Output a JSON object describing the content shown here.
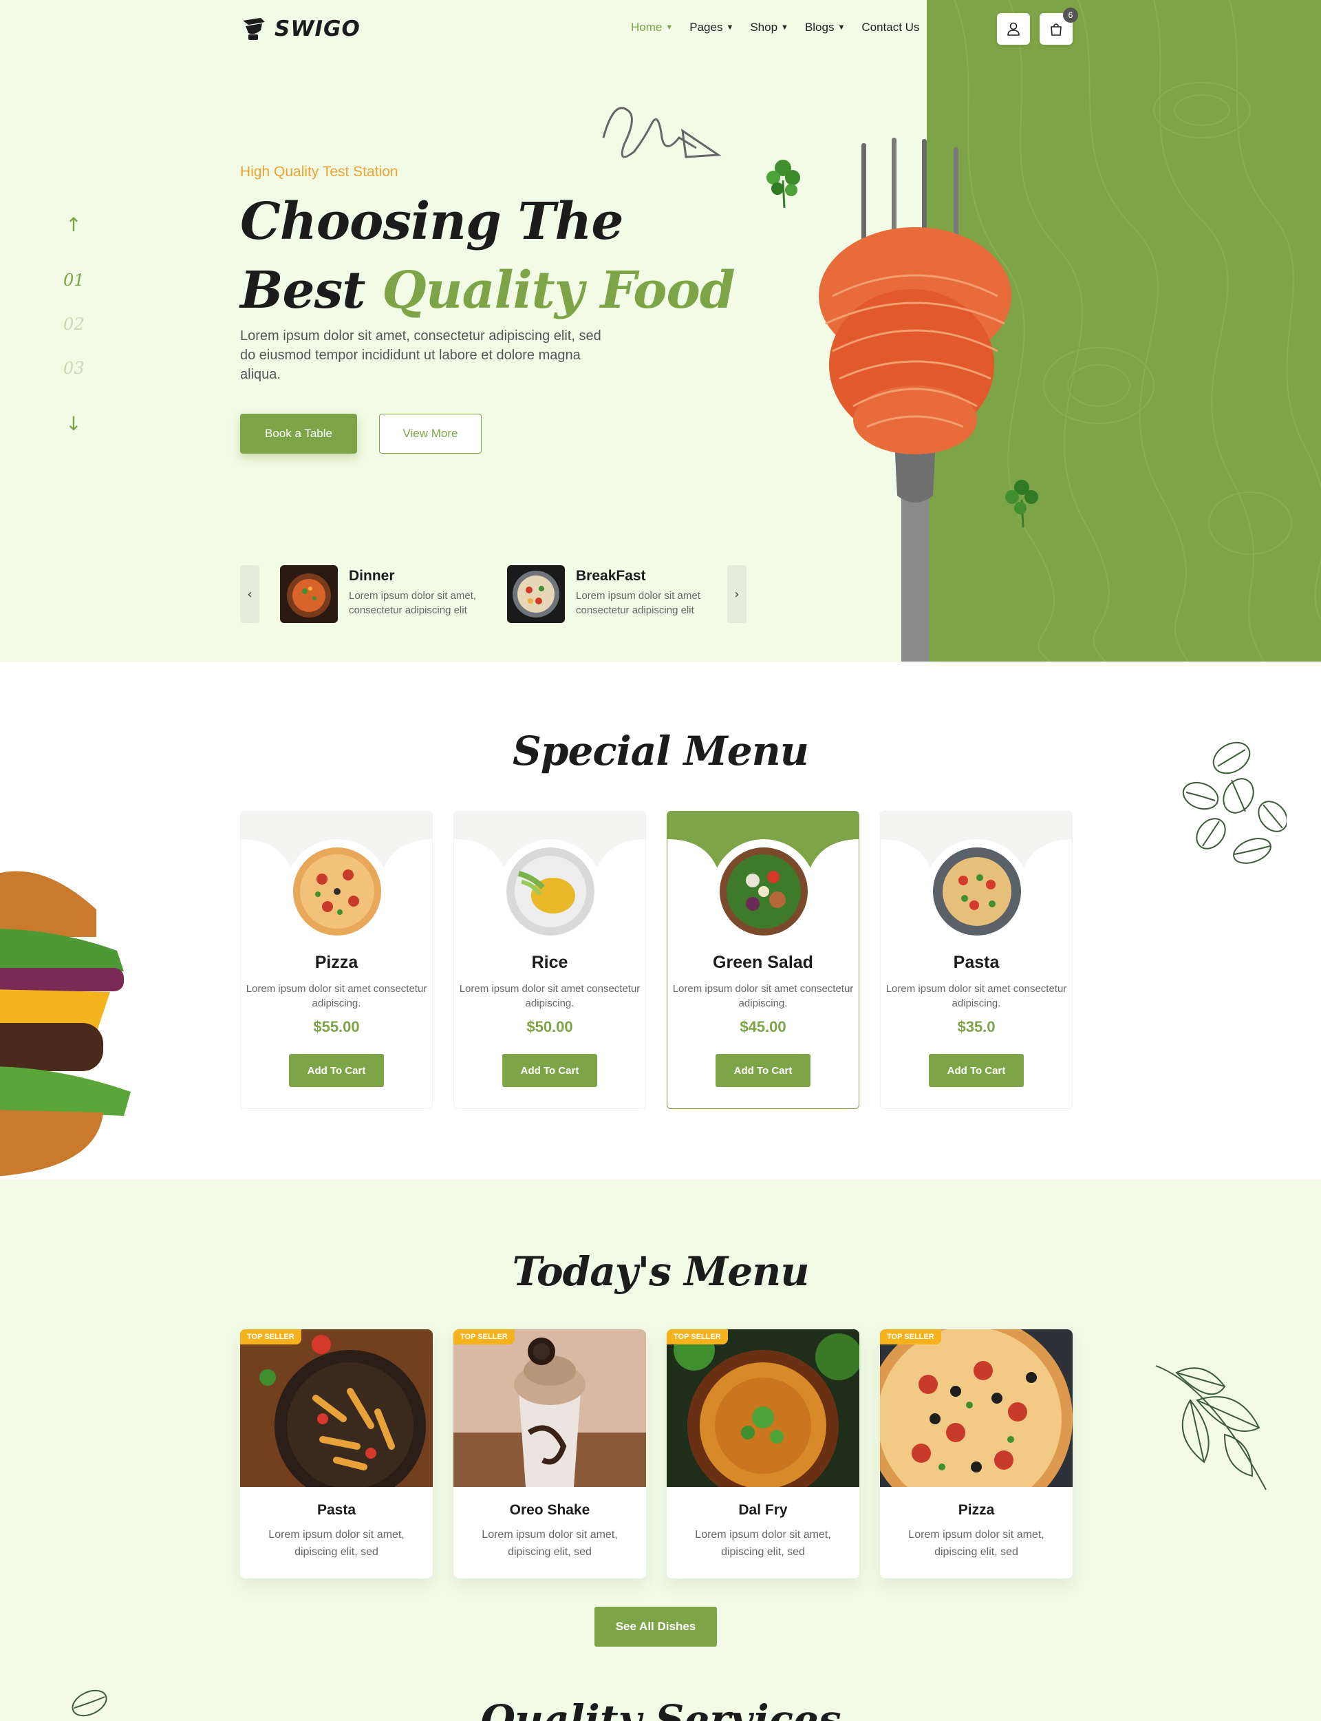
{
  "brand": {
    "name": "SWIGO"
  },
  "nav": {
    "items": [
      {
        "label": "Home",
        "active": true,
        "dropdown": true
      },
      {
        "label": "Pages",
        "dropdown": true
      },
      {
        "label": "Shop",
        "dropdown": true
      },
      {
        "label": "Blogs",
        "dropdown": true
      },
      {
        "label": "Contact Us",
        "dropdown": false
      }
    ],
    "cart_count": "6"
  },
  "hero": {
    "tag": "High Quality Test Station",
    "title_line1": "Choosing The",
    "title_line2_a": "Best ",
    "title_line2_b": "Quality Food",
    "description": "Lorem ipsum dolor sit amet, consectetur adipiscing elit, sed do eiusmod tempor incididunt ut labore et dolore magna aliqua.",
    "btn_primary": "Book a Table",
    "btn_secondary": "View More",
    "slides": [
      "01",
      "02",
      "03"
    ],
    "mini_cards": [
      {
        "title": "Dinner",
        "desc": "Lorem ipsum dolor sit amet, consectetur adipiscing elit"
      },
      {
        "title": "BreakFast",
        "desc": "Lorem ipsum dolor sit amet consectetur adipiscing elit"
      }
    ]
  },
  "special_menu": {
    "title": "Special Menu",
    "items": [
      {
        "name": "Pizza",
        "desc": "Lorem ipsum dolor sit amet consectetur adipiscing.",
        "price": "$55.00",
        "cta": "Add To Cart"
      },
      {
        "name": "Rice",
        "desc": "Lorem ipsum dolor sit amet consectetur adipiscing.",
        "price": "$50.00",
        "cta": "Add To Cart"
      },
      {
        "name": "Green Salad",
        "desc": "Lorem ipsum dolor sit amet consectetur adipiscing.",
        "price": "$45.00",
        "cta": "Add To Cart"
      },
      {
        "name": "Pasta",
        "desc": "Lorem ipsum dolor sit amet consectetur adipiscing.",
        "price": "$35.0",
        "cta": "Add To Cart"
      }
    ]
  },
  "todays_menu": {
    "title": "Today's Menu",
    "badge": "TOP SELLER",
    "items": [
      {
        "name": "Pasta",
        "desc": "Lorem ipsum dolor sit amet, dipiscing elit, sed"
      },
      {
        "name": "Oreo Shake",
        "desc": "Lorem ipsum dolor sit amet, dipiscing elit, sed"
      },
      {
        "name": "Dal Fry",
        "desc": "Lorem ipsum dolor sit amet, dipiscing elit, sed"
      },
      {
        "name": "Pizza",
        "desc": "Lorem ipsum dolor sit amet, dipiscing elit, sed"
      }
    ],
    "cta": "See All Dishes"
  },
  "next_section": {
    "title": "Quality Services"
  },
  "colors": {
    "accent": "#7da446",
    "hero_bg": "#f1fbe6",
    "tag": "#f0a133",
    "badge": "#f5b21c"
  }
}
